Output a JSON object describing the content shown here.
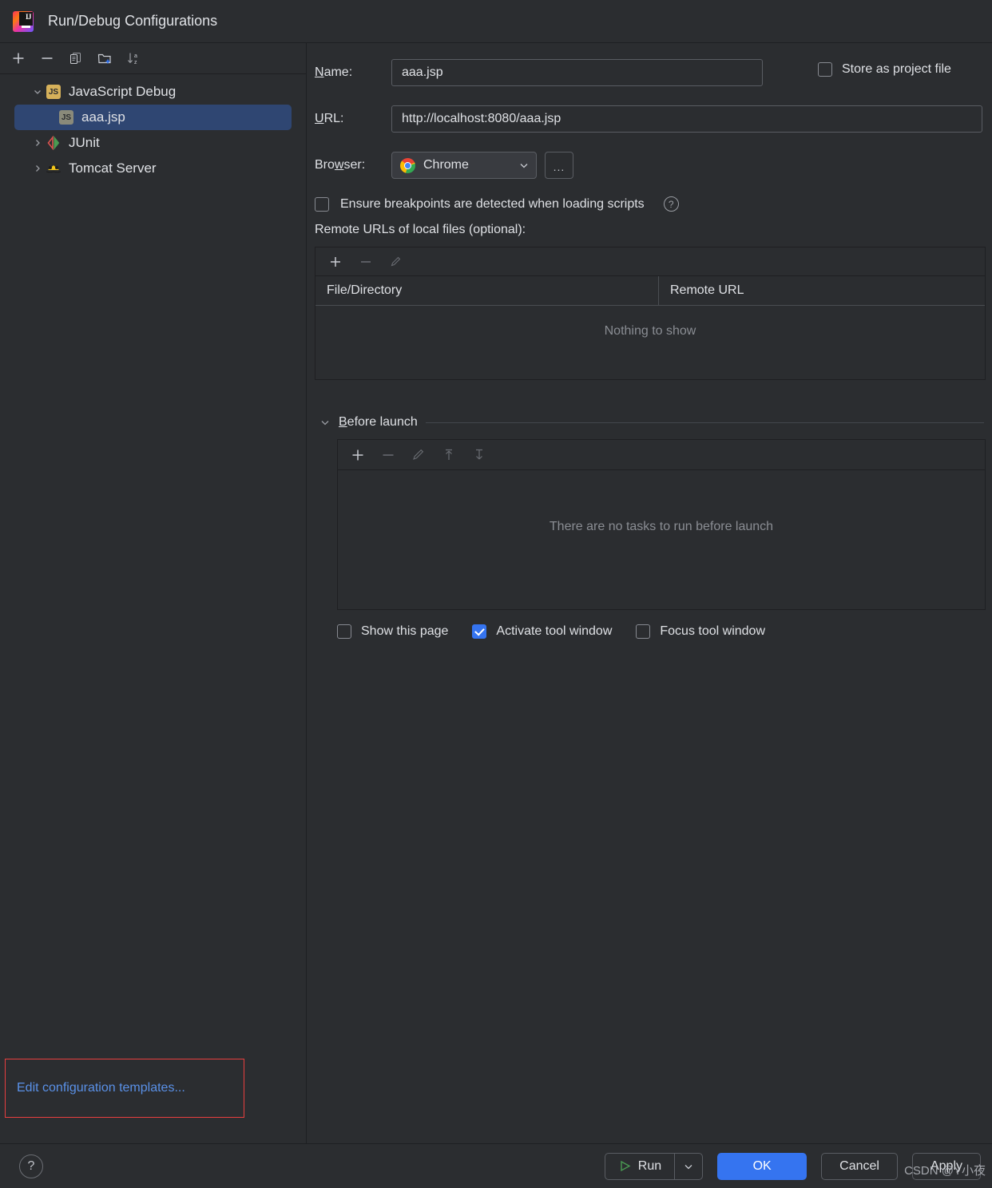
{
  "window": {
    "title": "Run/Debug Configurations",
    "app_icon": "intellij-idea-logo"
  },
  "sidebar": {
    "toolbar": [
      {
        "name": "add-configuration-button",
        "icon": "plus-icon",
        "label": "+"
      },
      {
        "name": "remove-configuration-button",
        "icon": "minus-icon",
        "label": "−"
      },
      {
        "name": "copy-configuration-button",
        "icon": "copy-icon",
        "label": "Copy"
      },
      {
        "name": "new-folder-button",
        "icon": "new-folder-icon",
        "label": "New Folder"
      },
      {
        "name": "sort-configurations-button",
        "icon": "sort-alpha-icon",
        "label": "Sort"
      }
    ],
    "tree": [
      {
        "label": "JavaScript Debug",
        "icon": "js-icon",
        "expanded": true,
        "level": 0,
        "selected": false
      },
      {
        "label": "aaa.jsp",
        "icon": "js-file-icon",
        "expanded": null,
        "level": 1,
        "selected": true
      },
      {
        "label": "JUnit",
        "icon": "junit-icon",
        "expanded": false,
        "level": 0,
        "selected": false
      },
      {
        "label": "Tomcat Server",
        "icon": "tomcat-icon",
        "expanded": false,
        "level": 0,
        "selected": false
      }
    ],
    "edit_templates_link": "Edit configuration templates..."
  },
  "form": {
    "name_label": "Name:",
    "name_label_mnemonic": "N",
    "name_value": "aaa.jsp",
    "store_as_project_file_label": "Store as project file",
    "store_as_project_file_checked": false,
    "url_label": "URL:",
    "url_label_mnemonic": "U",
    "url_value": "http://localhost:8080/aaa.jsp",
    "browser_label": "Browser:",
    "browser_label_mnemonic": "w",
    "browser_value": "Chrome",
    "browser_icon": "chrome-icon",
    "browser_more_button": "...",
    "ensure_breakpoints_label": "Ensure breakpoints are detected when loading scripts",
    "ensure_breakpoints_checked": false,
    "ensure_breakpoints_help": "?",
    "remote_urls_label": "Remote URLs of local files (optional):"
  },
  "remote_urls_table": {
    "toolbar": [
      {
        "name": "add-remote-url-button",
        "icon": "plus-icon"
      },
      {
        "name": "remove-remote-url-button",
        "icon": "minus-icon"
      },
      {
        "name": "edit-remote-url-button",
        "icon": "pencil-icon"
      }
    ],
    "columns": [
      "File/Directory",
      "Remote URL"
    ],
    "rows": [],
    "empty_text": "Nothing to show"
  },
  "before_launch": {
    "title": "Before launch",
    "title_mnemonic": "B",
    "expanded": true,
    "toolbar": [
      {
        "name": "add-task-button",
        "icon": "plus-icon"
      },
      {
        "name": "remove-task-button",
        "icon": "minus-icon"
      },
      {
        "name": "edit-task-button",
        "icon": "pencil-icon"
      },
      {
        "name": "move-task-up-button",
        "icon": "arrow-up-icon"
      },
      {
        "name": "move-task-down-button",
        "icon": "arrow-down-icon"
      }
    ],
    "empty_text": "There are no tasks to run before launch",
    "checkboxes": [
      {
        "label": "Show this page",
        "checked": false,
        "name": "show-this-page-checkbox"
      },
      {
        "label": "Activate tool window",
        "checked": true,
        "name": "activate-tool-window-checkbox"
      },
      {
        "label": "Focus tool window",
        "checked": false,
        "name": "focus-tool-window-checkbox"
      }
    ]
  },
  "footer": {
    "help_label": "?",
    "run_label": "Run",
    "run_dropdown_icon": "chevron-down-icon",
    "ok_label": "OK",
    "cancel_label": "Cancel",
    "apply_label": "Apply"
  },
  "watermark": {
    "text": "CSDN @Y小夜"
  },
  "colors": {
    "background": "#2b2d30",
    "accent_blue": "#3574f0",
    "selection_blue": "#2f4672",
    "link_blue": "#5a91e8",
    "highlight_red": "#e83f3f",
    "border_dark": "#1e1f22",
    "muted_text": "#8a8d93"
  }
}
